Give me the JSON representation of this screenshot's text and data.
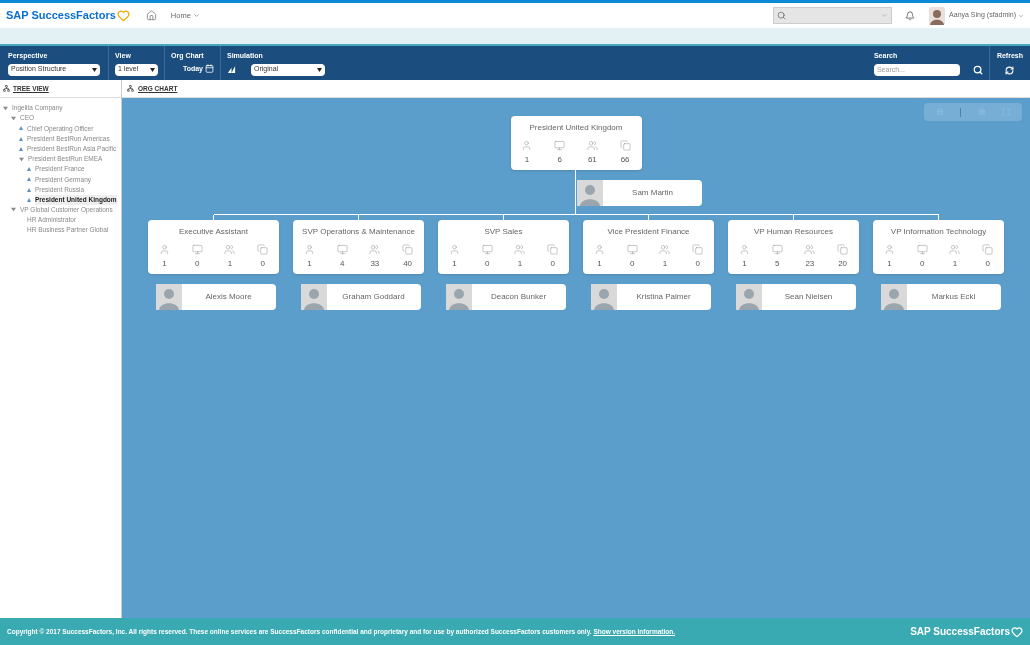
{
  "header": {
    "logo": "SAP SuccessFactors",
    "home": "Home",
    "user": "Aanya Sing (sfadmin)"
  },
  "toolbar": {
    "perspective": {
      "label": "Perspective",
      "value": "Position Structure"
    },
    "view": {
      "label": "View",
      "value": "1 level"
    },
    "org_chart": {
      "label": "Org Chart",
      "date": "Today"
    },
    "simulation": {
      "label": "Simulation",
      "value": "Original"
    },
    "search": {
      "label": "Search",
      "placeholder": "Search..."
    },
    "refresh": {
      "label": "Refresh"
    }
  },
  "sidebar": {
    "tab": "TREE VIEW",
    "tree": [
      {
        "label": "Ingelita Company",
        "expanded": true,
        "selected": false,
        "children": [
          {
            "label": "CEO",
            "expanded": true,
            "selected": false,
            "children": [
              {
                "label": "Chief Operating Officer",
                "expanded": false,
                "selected": false
              },
              {
                "label": "President BestRun Americas",
                "expanded": false,
                "selected": false
              },
              {
                "label": "President BestRun Asia Pacific",
                "expanded": false,
                "selected": false
              },
              {
                "label": "President BestRun EMEA",
                "expanded": true,
                "selected": false,
                "children": [
                  {
                    "label": "President France",
                    "expanded": false,
                    "selected": false
                  },
                  {
                    "label": "President Germany",
                    "expanded": false,
                    "selected": false
                  },
                  {
                    "label": "President Russia",
                    "expanded": false,
                    "selected": false
                  },
                  {
                    "label": "President United Kingdom",
                    "expanded": false,
                    "selected": true
                  }
                ]
              }
            ]
          },
          {
            "label": "VP Global Customer Operations",
            "expanded": true,
            "selected": false,
            "children": [
              {
                "label": "HR Administrator",
                "selected": false
              },
              {
                "label": "HR Business Partner Global",
                "selected": false
              }
            ]
          }
        ]
      }
    ]
  },
  "main": {
    "tab": "ORG CHART",
    "root": {
      "title": "President United Kingdom",
      "stats": [
        "1",
        "6",
        "61",
        "66"
      ],
      "person": "Sam Martin"
    },
    "children": [
      {
        "title": "Executive Assistant",
        "stats": [
          "1",
          "0",
          "1",
          "0"
        ],
        "person": "Alexis Moore"
      },
      {
        "title": "SVP Operations & Maintenance",
        "stats": [
          "1",
          "4",
          "33",
          "40"
        ],
        "person": "Graham Goddard"
      },
      {
        "title": "SVP Sales",
        "stats": [
          "1",
          "0",
          "1",
          "0"
        ],
        "person": "Deacon Bunker"
      },
      {
        "title": "Vice President Finance",
        "stats": [
          "1",
          "0",
          "1",
          "0"
        ],
        "person": "Kristina Palmer"
      },
      {
        "title": "VP Human Resources",
        "stats": [
          "1",
          "5",
          "23",
          "20"
        ],
        "person": "Sean Nielsen"
      },
      {
        "title": "VP Information Technology",
        "stats": [
          "1",
          "0",
          "1",
          "0"
        ],
        "person": "Markus Eckl"
      }
    ]
  },
  "footer": {
    "copyright": "Copyright © 2017 SuccessFactors, Inc. All rights reserved. These online services are SuccessFactors confidential and proprietary and for use by authorized SuccessFactors customers only.",
    "link": "Show version information.",
    "logo": "SAP SuccessFactors"
  }
}
